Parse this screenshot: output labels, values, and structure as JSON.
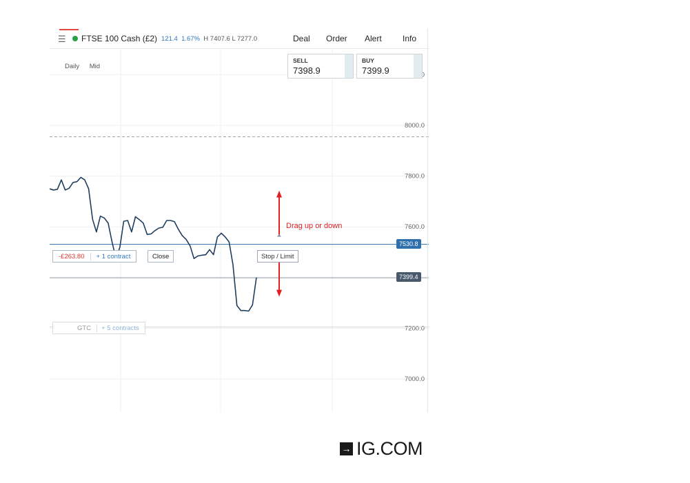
{
  "header": {
    "menu_icon": "hamburger-icon",
    "market_name": "FTSE 100 Cash (£2)",
    "status_color": "#27a243",
    "change": "121.4",
    "change_pct": "1.67%",
    "high_low": "H 7407.6 L 7277.0",
    "nav": [
      "Deal",
      "Order",
      "Alert",
      "Info"
    ]
  },
  "toolbar": {
    "interval": "Daily",
    "price_type": "Mid"
  },
  "deal": {
    "sell_label": "SELL",
    "sell_price": "7398.9",
    "buy_label": "BUY",
    "buy_price": "7399.9"
  },
  "axis_labels": [
    "8200.0",
    "8000.0",
    "7800.0",
    "7600.0",
    "7200.0",
    "7000.0"
  ],
  "price_tags": {
    "position": "7530.8",
    "current": "7399.4"
  },
  "position_line": {
    "pnl": "-£263.80",
    "contracts": "+ 1 contract",
    "close_label": "Close",
    "stop_limit_label": "Stop / Limit"
  },
  "annotation": {
    "text": "Drag up or down",
    "color": "#e02020"
  },
  "working_order": {
    "type": "GTC",
    "contracts": "+ 5 contracts"
  },
  "colors": {
    "line": "#1f3d5c",
    "position_tag": "#2f6fad",
    "current_tag": "#48596c",
    "loss": "#d9342b",
    "accent": "#2f79c0"
  },
  "brand": {
    "logo_icon": "arrow-right-icon",
    "name": "IG.COM"
  },
  "chart_data": {
    "type": "line",
    "y_axis_labels": [
      8200,
      8000,
      7800,
      7600,
      7200,
      7000
    ],
    "series": [
      {
        "values": [
          7750,
          7745,
          7748,
          7785,
          7745,
          7752,
          7775,
          7778,
          7795,
          7785,
          7750,
          7630,
          7580,
          7642,
          7635,
          7615,
          7540,
          7475,
          7520,
          7622,
          7625,
          7580,
          7640,
          7628,
          7615,
          7570,
          7572,
          7585,
          7595,
          7598,
          7625,
          7625,
          7620,
          7590,
          7565,
          7550,
          7525,
          7475,
          7485,
          7488,
          7490,
          7510,
          7490,
          7560,
          7575,
          7560,
          7540,
          7450,
          7290,
          7270,
          7270,
          7268,
          7292,
          7400
        ]
      }
    ],
    "horizontal_levels": {
      "dashed": 7955,
      "position": 7530.8,
      "current": 7399.4,
      "working_order": 7205
    },
    "ylim": [
      6870,
      8380
    ]
  }
}
